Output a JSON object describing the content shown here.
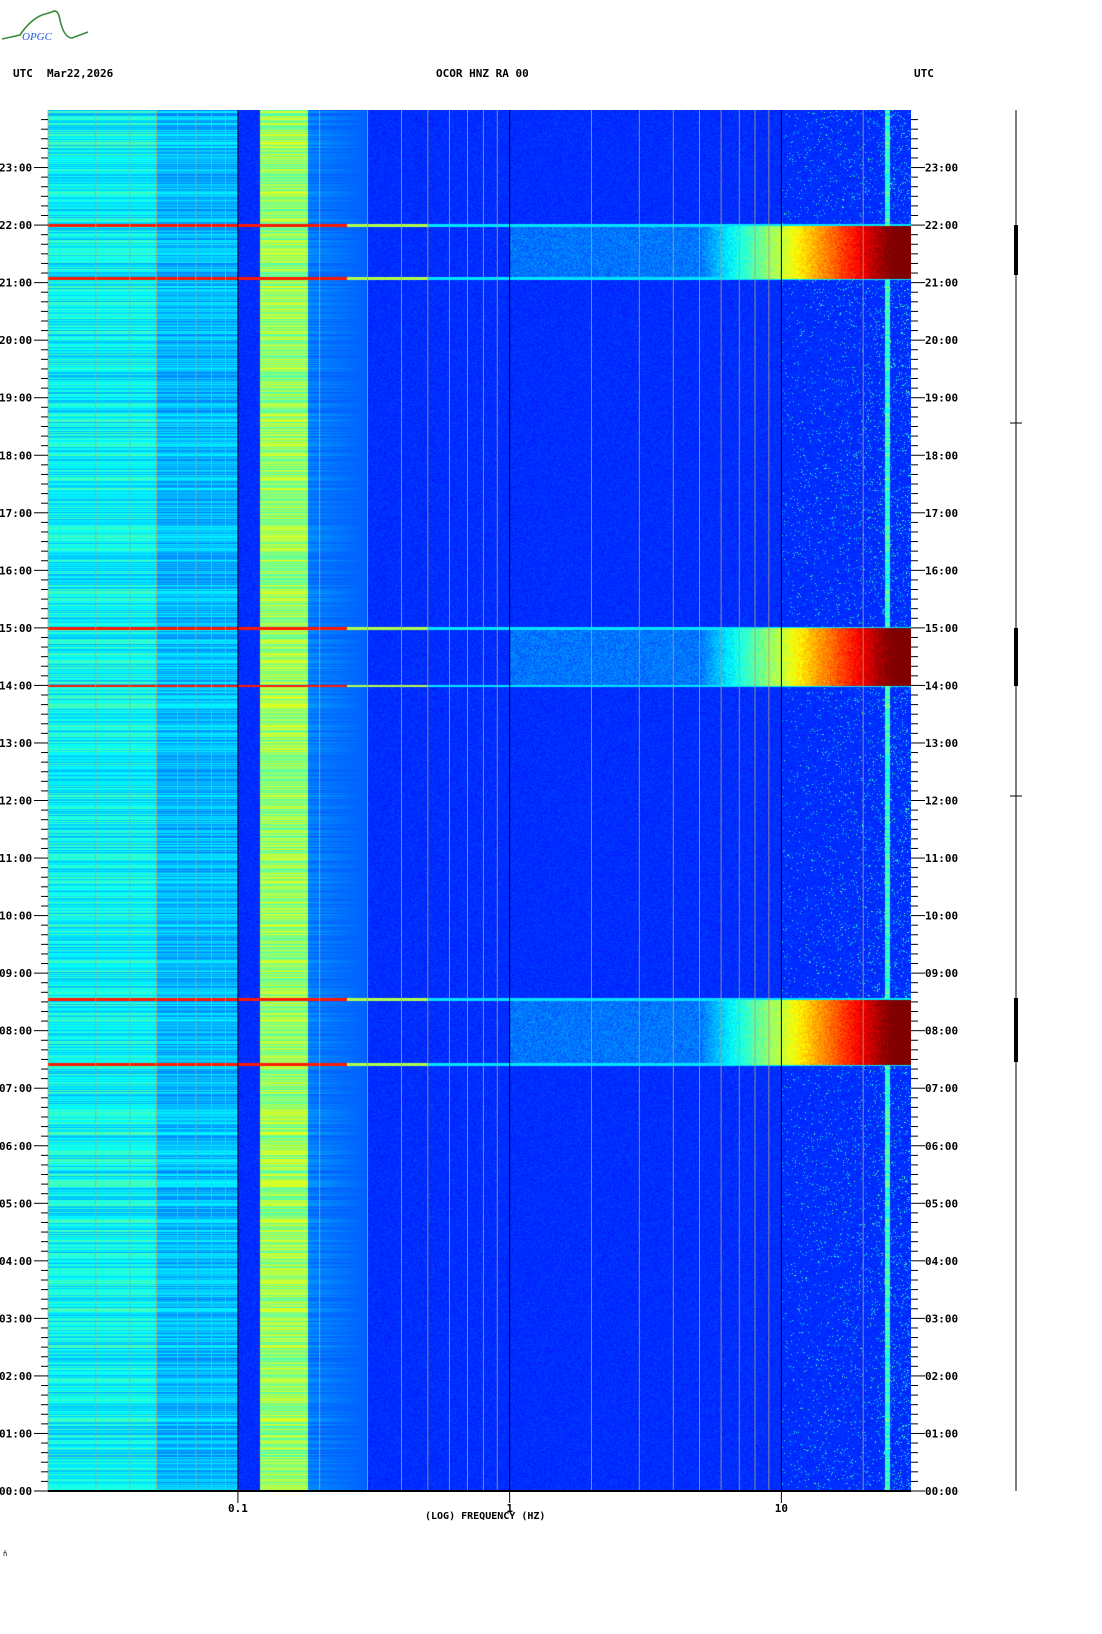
{
  "header": {
    "left_timezone": "UTC",
    "date": "Mar22,2026",
    "station_title": "OCOR HNZ RA 00",
    "right_timezone": "UTC"
  },
  "logo_text": "OPGC",
  "footer_mark": "ñ",
  "chart_data": {
    "type": "heatmap",
    "title": "OCOR HNZ RA 00",
    "xlabel": "(LOG) FREQUENCY (HZ)",
    "ylabel": "UTC",
    "xscale": "log",
    "xlim": [
      0.02,
      30
    ],
    "x_tick_labels": [
      "0.1",
      "1",
      "10"
    ],
    "x_tick_values": [
      0.1,
      1,
      10
    ],
    "ylim_hours": [
      0,
      24
    ],
    "y_tick_labels": [
      "00:00",
      "01:00",
      "02:00",
      "03:00",
      "04:00",
      "05:00",
      "06:00",
      "07:00",
      "08:00",
      "09:00",
      "10:00",
      "11:00",
      "12:00",
      "13:00",
      "14:00",
      "15:00",
      "16:00",
      "17:00",
      "18:00",
      "19:00",
      "20:00",
      "21:00",
      "22:00",
      "23:00"
    ],
    "colormap": "jet",
    "background_features": [
      {
        "name": "microseism band",
        "freq_hz": [
          0.12,
          0.18
        ],
        "level": 0.45
      },
      {
        "name": "low frequency noise",
        "freq_hz": [
          0.02,
          0.05
        ],
        "level": 0.3
      },
      {
        "name": "high frequency line",
        "freq_hz": [
          24,
          25
        ],
        "level": 0.35
      }
    ],
    "events": [
      {
        "start_hour": 7.42,
        "end_hour": 8.55,
        "freq_min_hz": 5,
        "peak_level": 1.0
      },
      {
        "start_hour": 14.0,
        "end_hour": 15.0,
        "freq_min_hz": 5,
        "peak_level": 1.0
      },
      {
        "start_hour": 21.08,
        "end_hour": 22.0,
        "freq_min_hz": 5,
        "peak_level": 1.0
      }
    ]
  }
}
